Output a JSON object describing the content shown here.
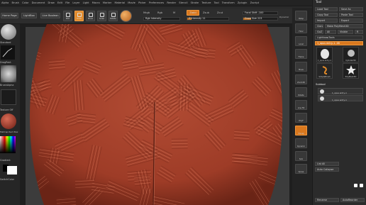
{
  "menu": [
    "Alpha",
    "Brush",
    "Color",
    "Document",
    "Draw",
    "Edit",
    "File",
    "Layer",
    "Light",
    "Macro",
    "Marker",
    "Material",
    "Movie",
    "Picker",
    "Preferences",
    "Render",
    "Stencil",
    "Stroke",
    "Texture",
    "Tool",
    "Transform",
    "Zplugin",
    "Zscript"
  ],
  "toolbar": {
    "home_label": "Home Page",
    "lightbox_label": "LightBox",
    "live_boolean_label": "Live Boolean",
    "mrgb_label": "Mrgb",
    "rgb_label": "Rgb",
    "m_label": "M",
    "zadd_label": "Zadd",
    "zsub_label": "Zsub",
    "zcut_label": "Zcut",
    "focal_shift": "Focal Shift -100",
    "draw_size": "Draw Size 223",
    "z_intensity": "Z Intensity 11",
    "rgb_intensity": "Rgb Intensity",
    "dynamic_label": "Dynamic",
    "tools": [
      "Edit",
      "Draw",
      "Move",
      "Scale",
      "Rotate"
    ]
  },
  "left": {
    "standard": "Standard",
    "dragrect": "DragRect",
    "alpha_off": "BrushAlpha",
    "texture_off": "Texture Off",
    "material": "MatCap Red Wax",
    "gradient": "Gradient",
    "switch_color": "SwitchColor"
  },
  "right_shelf": [
    "Persp",
    "Floor",
    "Local",
    "Frame",
    "Move",
    "Zoom3D",
    "Rotate",
    "Line Fill",
    "PolyF",
    "Transp",
    "Dynamic",
    "Solo",
    "Xpose"
  ],
  "panel": {
    "title": "Tool",
    "load_tool": "Load Tool",
    "save_as": "Save As",
    "copy_tool": "Copy Tool",
    "paste_tool": "Paste Tool",
    "import": "Import",
    "export": "Export",
    "clone": "Clone",
    "make_polymesh": "Make PolyMesh3D",
    "goz": "GoZ",
    "all": "All",
    "visible": "Visible",
    "r": "R",
    "lightbox_tools": "Lightbox▸Tools",
    "current_tool": "1_opus entry-1. 48",
    "thumbs": [
      "1_opus entry-1",
      "Cylinder3D",
      "PolyMesh3D",
      "SimpleBrush",
      "1_opus entry-1"
    ],
    "subtool_header": "Subtool",
    "subtools": [
      "1_opus entry-1",
      "1_opus entry-1"
    ],
    "list_all": "List All",
    "auto_collapse": "Auto Collapse",
    "rename": "Rename",
    "autoreorder": "AutoReorder"
  },
  "colors": {
    "accent": "#e08a2a",
    "wax": "#a8432d",
    "wax_dark": "#7a2c1c",
    "wax_light": "#d47a5e"
  }
}
